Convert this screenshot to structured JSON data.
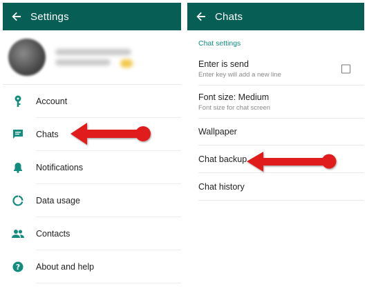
{
  "left": {
    "title": "Settings",
    "items": [
      {
        "label": "Account",
        "icon": "key-icon"
      },
      {
        "label": "Chats",
        "icon": "chat-icon"
      },
      {
        "label": "Notifications",
        "icon": "bell-icon"
      },
      {
        "label": "Data usage",
        "icon": "data-usage-icon"
      },
      {
        "label": "Contacts",
        "icon": "contacts-icon"
      },
      {
        "label": "About and help",
        "icon": "help-icon"
      }
    ]
  },
  "right": {
    "title": "Chats",
    "section": "Chat settings",
    "items": [
      {
        "title": "Enter is send",
        "subtitle": "Enter key will add a new line",
        "checked": false
      },
      {
        "title": "Font size: Medium",
        "subtitle": "Font size for chat screen"
      },
      {
        "title": "Wallpaper"
      },
      {
        "title": "Chat backup"
      },
      {
        "title": "Chat history"
      }
    ]
  },
  "colors": {
    "appbar": "#075e54",
    "icon": "#128c7e",
    "section_header": "#128c7e",
    "arrow": "#e01b1b"
  }
}
